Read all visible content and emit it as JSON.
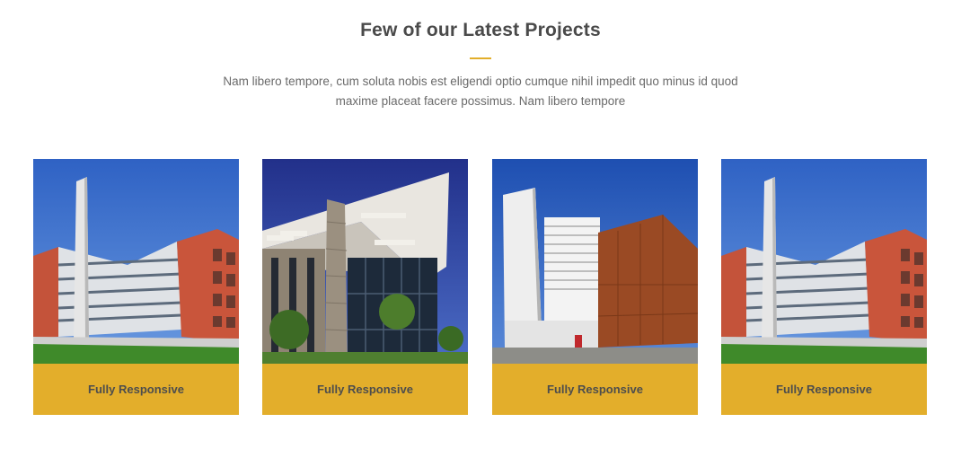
{
  "section": {
    "title": "Few of our Latest Projects",
    "description": "Nam libero tempore, cum soluta nobis est eligendi optio cumque nihil impedit quo minus id quod maxime placeat facere possimus. Nam libero tempore",
    "accent_color": "#e3ae2b"
  },
  "projects": [
    {
      "caption": "Fully Responsive",
      "image": "building-brick-tower-photo"
    },
    {
      "caption": "Fully Responsive",
      "image": "building-glass-canopy-photo"
    },
    {
      "caption": "Fully Responsive",
      "image": "building-rust-facade-photo"
    },
    {
      "caption": "Fully Responsive",
      "image": "building-brick-tower-photo"
    }
  ]
}
